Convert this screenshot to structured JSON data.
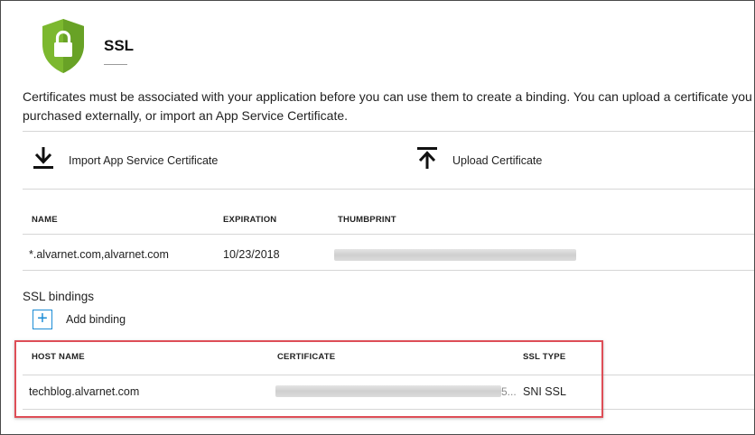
{
  "header": {
    "title": "SSL",
    "icon": "shield-lock-icon",
    "icon_color": "#7cb82f"
  },
  "description": {
    "line1": "Certificates must be associated with your application before you can use them to create a binding. You can upload a certificate you",
    "line2": "purchased externally, or import an App Service Certificate."
  },
  "commands": {
    "import_label": "Import App Service Certificate",
    "upload_label": "Upload Certificate"
  },
  "certificates_table": {
    "columns": [
      "NAME",
      "EXPIRATION",
      "THUMBPRINT"
    ],
    "rows": [
      {
        "name": "*.alvarnet.com,alvarnet.com",
        "expiration": "10/23/2018",
        "thumbprint": ""
      }
    ]
  },
  "bindings": {
    "section_title": "SSL bindings",
    "add_label": "Add binding",
    "columns": [
      "HOST NAME",
      "CERTIFICATE",
      "SSL TYPE"
    ],
    "rows": [
      {
        "host_name": "techblog.alvarnet.com",
        "certificate_suffix": "5...",
        "ssl_type": "SNI SSL"
      }
    ]
  },
  "colors": {
    "accent": "#1b8cd6",
    "highlight": "#de4e57"
  }
}
